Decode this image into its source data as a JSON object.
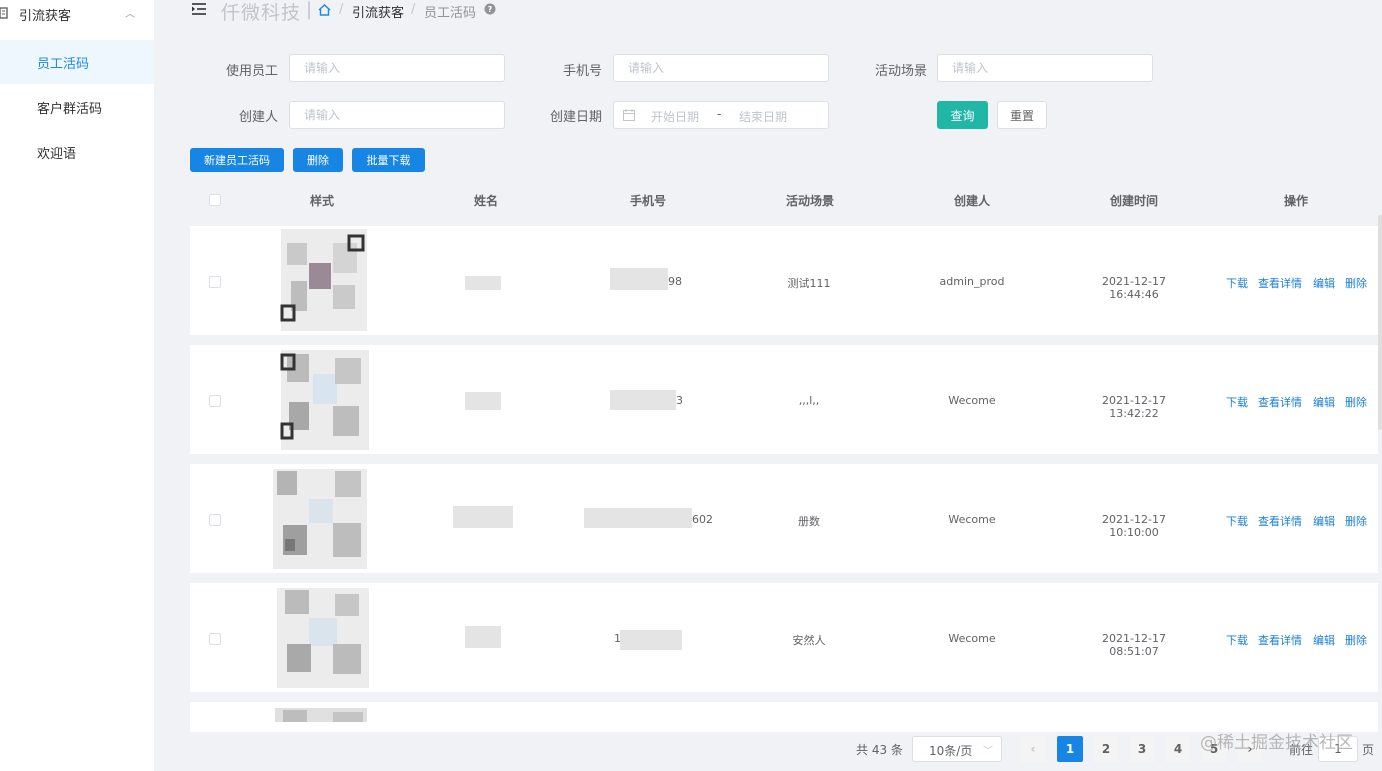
{
  "sidebar": {
    "group_label": "引流获客",
    "items": [
      {
        "label": "员工活码",
        "active": true
      },
      {
        "label": "客户群活码",
        "active": false
      },
      {
        "label": "欢迎语",
        "active": false
      }
    ]
  },
  "header": {
    "brand": "仟微科技",
    "separator": "|",
    "breadcrumb": [
      "引流获客",
      "员工活码"
    ],
    "breadcrumb_sep": "/"
  },
  "filters": {
    "employee_label": "使用员工",
    "employee_placeholder": "请输入",
    "phone_label": "手机号",
    "phone_placeholder": "请输入",
    "scene_label": "活动场景",
    "scene_placeholder": "请输入",
    "creator_label": "创建人",
    "creator_placeholder": "请输入",
    "date_label": "创建日期",
    "date_start_placeholder": "开始日期",
    "date_sep": "-",
    "date_end_placeholder": "结束日期",
    "search_button": "查询",
    "reset_button": "重置"
  },
  "actions": {
    "new_button": "新建员工活码",
    "delete_button": "删除",
    "batch_download_button": "批量下载"
  },
  "table": {
    "columns": [
      "样式",
      "姓名",
      "手机号",
      "活动场景",
      "创建人",
      "创建时间",
      "操作"
    ],
    "rows": [
      {
        "phone_tail": "98",
        "scene": "测试111",
        "creator": "admin_prod",
        "created": "2021-12-17 16:44:46"
      },
      {
        "phone_tail": "3",
        "scene": ",,,l,,",
        "creator": "Wecome",
        "created": "2021-12-17 13:42:22"
      },
      {
        "phone_tail": "602",
        "scene": "册数",
        "creator": "Wecome",
        "created": "2021-12-17 10:10:00"
      },
      {
        "phone_tail": "1",
        "scene": "安然人",
        "creator": "Wecome",
        "created": "2021-12-17 08:51:07"
      }
    ],
    "ops": {
      "download": "下载",
      "detail": "查看详情",
      "edit": "编辑",
      "delete": "删除"
    }
  },
  "pagination": {
    "total_text": "共 43 条",
    "page_size": "10条/页",
    "prev": "‹",
    "pages": [
      "1",
      "2",
      "3",
      "4",
      "5"
    ],
    "current_page": "1",
    "next": "›",
    "goto_label": "前往",
    "goto_value": "1",
    "page_suffix": "页"
  },
  "watermark": "@稀土掘金技术社区",
  "colors": {
    "primary": "#1685e4",
    "teal": "#21b7a6",
    "link": "#1a7fd6",
    "active_menu": "#1d8ae5"
  }
}
